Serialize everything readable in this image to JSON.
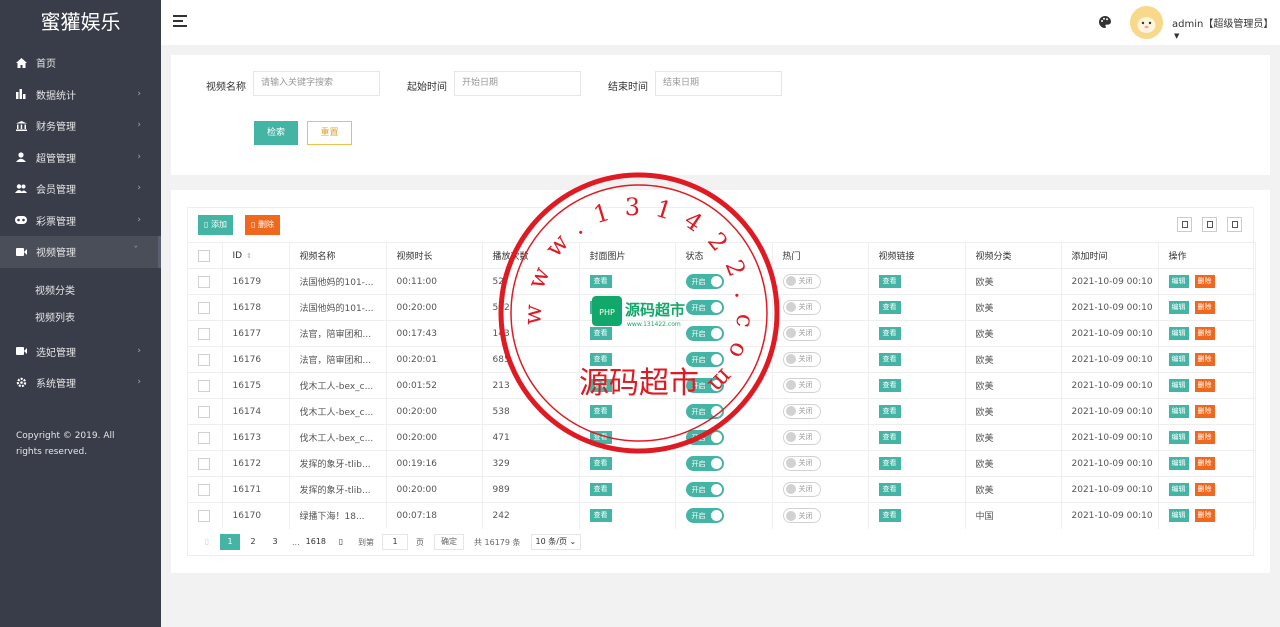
{
  "app": {
    "title": "蜜獾娱乐"
  },
  "sidebar": {
    "items": [
      {
        "label": "首页",
        "icon": "home-icon"
      },
      {
        "label": "数据统计",
        "icon": "bar-chart-icon"
      },
      {
        "label": "财务管理",
        "icon": "bank-icon"
      },
      {
        "label": "超管管理",
        "icon": "user-icon"
      },
      {
        "label": "会员管理",
        "icon": "users-icon"
      },
      {
        "label": "彩票管理",
        "icon": "gamepad-icon"
      },
      {
        "label": "视频管理",
        "icon": "video-icon"
      },
      {
        "label": "选妃管理",
        "icon": "video-icon"
      },
      {
        "label": "系统管理",
        "icon": "gear-icon"
      }
    ],
    "subitems": [
      {
        "label": "视频分类"
      },
      {
        "label": "视频列表"
      }
    ],
    "copyright": "Copyright © 2019. All rights reserved."
  },
  "header": {
    "user": "admin【超级管理员】"
  },
  "search": {
    "name_label": "视频名称",
    "name_placeholder": "请输入关键字搜索",
    "start_label": "起始时间",
    "start_placeholder": "开始日期",
    "end_label": "结束时间",
    "end_placeholder": "结束日期",
    "search_btn": "检索",
    "reset_btn": "重置"
  },
  "toolbar": {
    "add_label": "添加",
    "delete_label": "删除"
  },
  "table": {
    "columns": [
      "ID",
      "视频名称",
      "视频时长",
      "播放次数",
      "封面图片",
      "状态",
      "热门",
      "视频链接",
      "视频分类",
      "添加时间",
      "操作"
    ],
    "view_label": "查看",
    "on_label": "开启",
    "off_label": "关闭",
    "edit_label": "编辑",
    "del_label": "删除",
    "rows": [
      {
        "id": "16179",
        "name": "法国他妈的101-...",
        "duration": "00:11:00",
        "plays": "52",
        "category": "欧美",
        "added": "2021-10-09 00:10"
      },
      {
        "id": "16178",
        "name": "法国他妈的101-...",
        "duration": "00:20:00",
        "plays": "562",
        "category": "欧美",
        "added": "2021-10-09 00:10"
      },
      {
        "id": "16177",
        "name": "法官，陪审团和...",
        "duration": "00:17:43",
        "plays": "143",
        "category": "欧美",
        "added": "2021-10-09 00:10"
      },
      {
        "id": "16176",
        "name": "法官，陪审团和...",
        "duration": "00:20:01",
        "plays": "685",
        "category": "欧美",
        "added": "2021-10-09 00:10"
      },
      {
        "id": "16175",
        "name": "伐木工人-bex_c...",
        "duration": "00:01:52",
        "plays": "213",
        "category": "欧美",
        "added": "2021-10-09 00:10"
      },
      {
        "id": "16174",
        "name": "伐木工人-bex_c...",
        "duration": "00:20:00",
        "plays": "538",
        "category": "欧美",
        "added": "2021-10-09 00:10"
      },
      {
        "id": "16173",
        "name": "伐木工人-bex_c...",
        "duration": "00:20:00",
        "plays": "471",
        "category": "欧美",
        "added": "2021-10-09 00:10"
      },
      {
        "id": "16172",
        "name": "发挥的象牙-tlib...",
        "duration": "00:19:16",
        "plays": "329",
        "category": "欧美",
        "added": "2021-10-09 00:10"
      },
      {
        "id": "16171",
        "name": "发挥的象牙-tlib...",
        "duration": "00:20:00",
        "plays": "989",
        "category": "欧美",
        "added": "2021-10-09 00:10"
      },
      {
        "id": "16170",
        "name": "绿播下海！18...",
        "duration": "00:07:18",
        "plays": "242",
        "category": "中国",
        "added": "2021-10-09 00:10"
      }
    ]
  },
  "pager": {
    "pages": [
      "1",
      "2",
      "3"
    ],
    "ellipsis": "...",
    "last": "1618",
    "goto_label": "到第",
    "goto_value": "1",
    "page_unit": "页",
    "confirm": "确定",
    "total": "共 16179 条",
    "page_size": "10 条/页"
  },
  "watermark": {
    "ring_text": "www.131422.com",
    "center_text": "源码超市",
    "logo_text": "源码超市",
    "logo_sub": "www.131422.com",
    "logo_badge": "PHP"
  },
  "colors": {
    "sidebar_bg": "#393d49",
    "accent": "#44b4a5",
    "danger": "#f0681e",
    "warn_border": "#f0c04a",
    "stamp": "#e01a22"
  }
}
